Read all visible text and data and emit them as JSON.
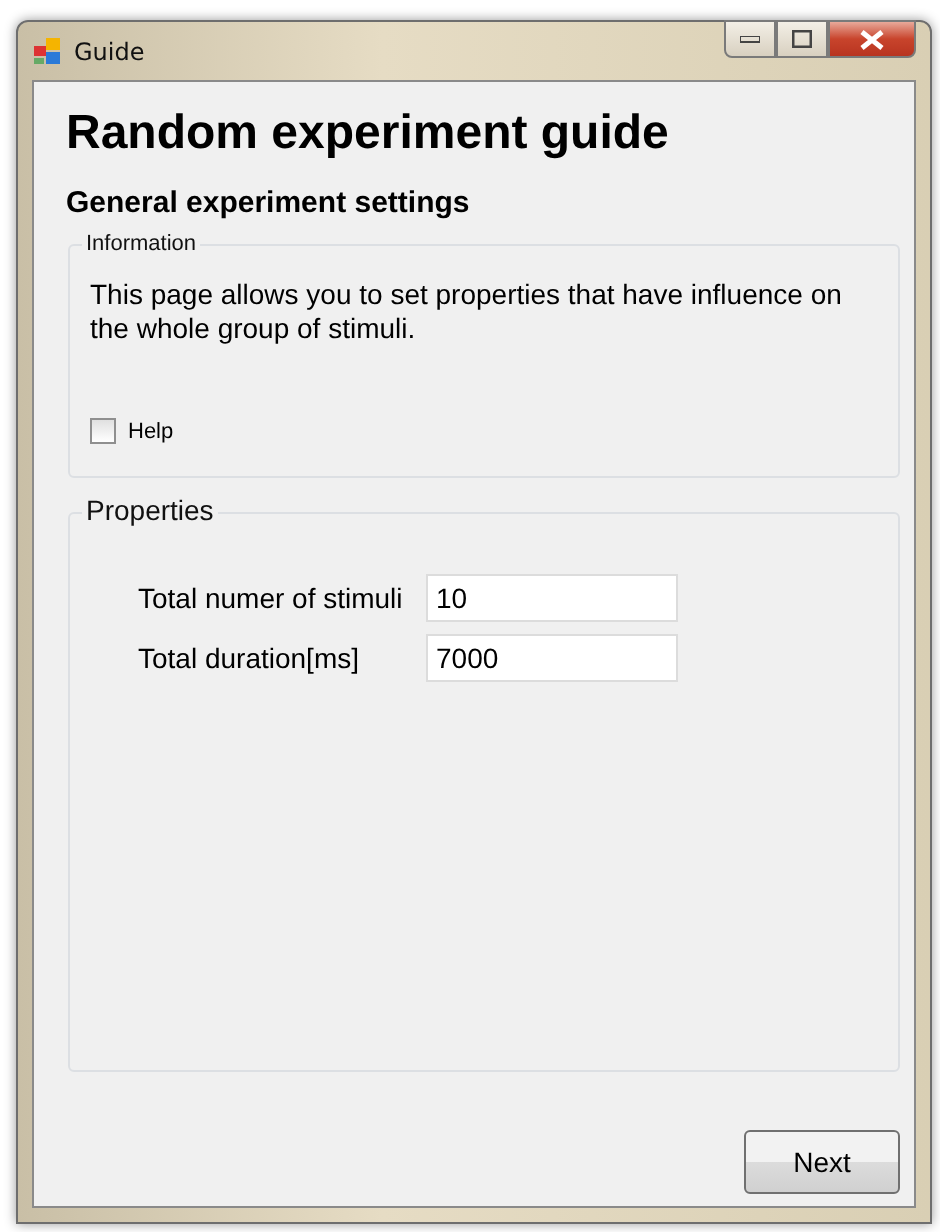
{
  "window": {
    "title": "Guide"
  },
  "heading": "Random experiment guide",
  "subheading": "General experiment settings",
  "information": {
    "legend": "Information",
    "text": "This page allows you to set properties that have influence on the whole group of stimuli.",
    "help": {
      "label": "Help",
      "checked": false
    }
  },
  "properties": {
    "legend": "Properties",
    "fields": [
      {
        "label": "Total numer of stimuli",
        "value": "10"
      },
      {
        "label": "Total duration[ms]",
        "value": "7000"
      }
    ]
  },
  "buttons": [
    "Next"
  ]
}
